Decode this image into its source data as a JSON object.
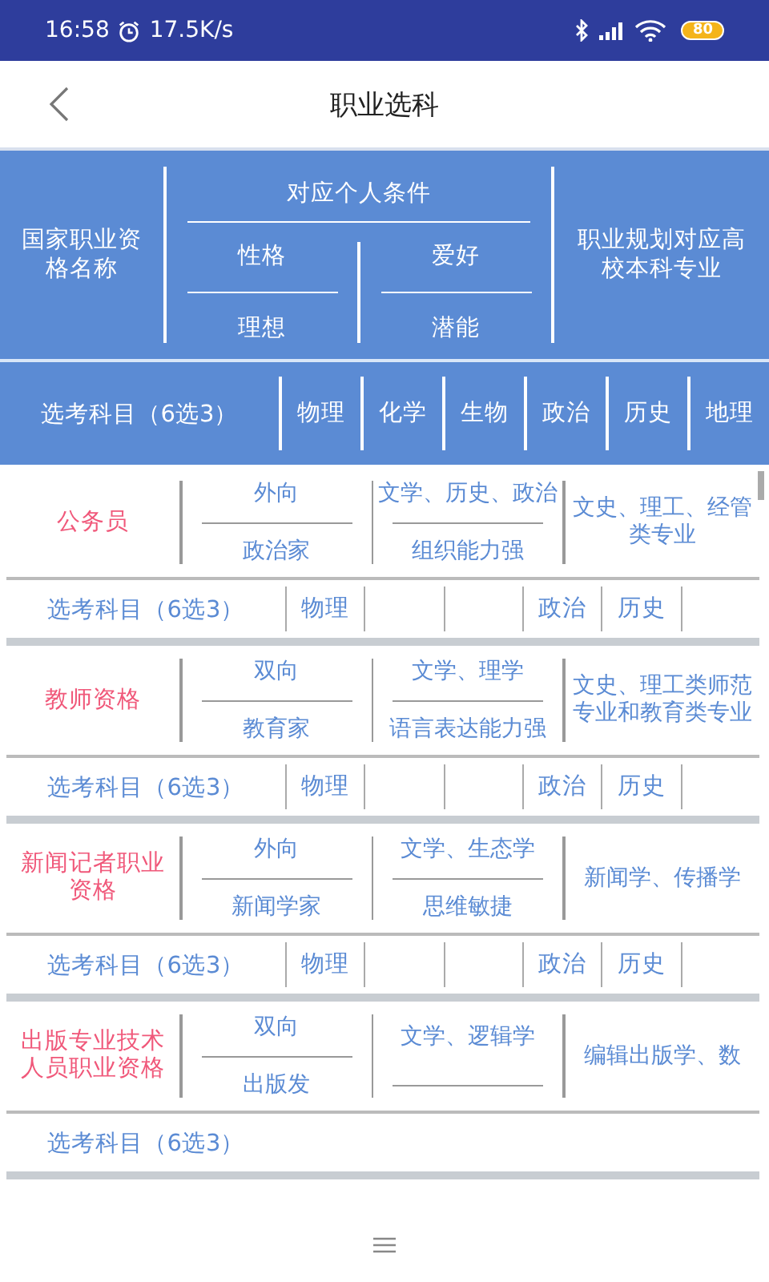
{
  "status_bar": {
    "time": "16:58",
    "net_speed": "17.5K/s",
    "battery": "80"
  },
  "header": {
    "title": "职业选科"
  },
  "table_head": {
    "name_heading": "国家职业资格名称",
    "conditions_heading": "对应个人条件",
    "condition_labels": [
      "性格",
      "爱好",
      "理想",
      "潜能"
    ],
    "majors_heading": "职业规划对应高校本科专业",
    "subjects_label": "选考科目（6选3）",
    "subjects": [
      "物理",
      "化学",
      "生物",
      "政治",
      "历史",
      "地理"
    ]
  },
  "careers": [
    {
      "name": "公务员",
      "personality": "外向",
      "interest": "文学、历史、政治",
      "ideal": "政治家",
      "potential": "组织能力强",
      "majors": "文史、理工、经管类专业",
      "subjects_label": "选考科目（6选3）",
      "subjects": [
        {
          "kind": "subject",
          "label": "物理"
        },
        {
          "kind": "blank"
        },
        {
          "kind": "blank"
        },
        {
          "kind": "subject",
          "label": "政治"
        },
        {
          "kind": "subject",
          "label": "历史"
        },
        {
          "kind": "blank"
        }
      ]
    },
    {
      "name": "教师资格",
      "personality": "双向",
      "interest": "文学、理学",
      "ideal": "教育家",
      "potential": "语言表达能力强",
      "majors": "文史、理工类师范专业和教育类专业",
      "subjects_label": "选考科目（6选3）",
      "subjects": [
        {
          "kind": "subject",
          "label": "物理"
        },
        {
          "kind": "blank"
        },
        {
          "kind": "blank"
        },
        {
          "kind": "subject",
          "label": "政治"
        },
        {
          "kind": "subject",
          "label": "历史"
        },
        {
          "kind": "blank"
        }
      ]
    },
    {
      "name": "新闻记者职业资格",
      "personality": "外向",
      "interest": "文学、生态学",
      "ideal": "新闻学家",
      "potential": "思维敏捷",
      "majors": "新闻学、传播学",
      "subjects_label": "选考科目（6选3）",
      "subjects": [
        {
          "kind": "subject",
          "label": "物理"
        },
        {
          "kind": "blank"
        },
        {
          "kind": "blank"
        },
        {
          "kind": "subject",
          "label": "政治"
        },
        {
          "kind": "subject",
          "label": "历史"
        },
        {
          "kind": "blank"
        }
      ]
    },
    {
      "name": "出版专业技术人员职业资格",
      "personality": "双向",
      "interest": "文学、逻辑学",
      "ideal": "出版发",
      "majors": "编辑出版学、数",
      "subjects_label": "选考科目（6选3）"
    }
  ]
}
